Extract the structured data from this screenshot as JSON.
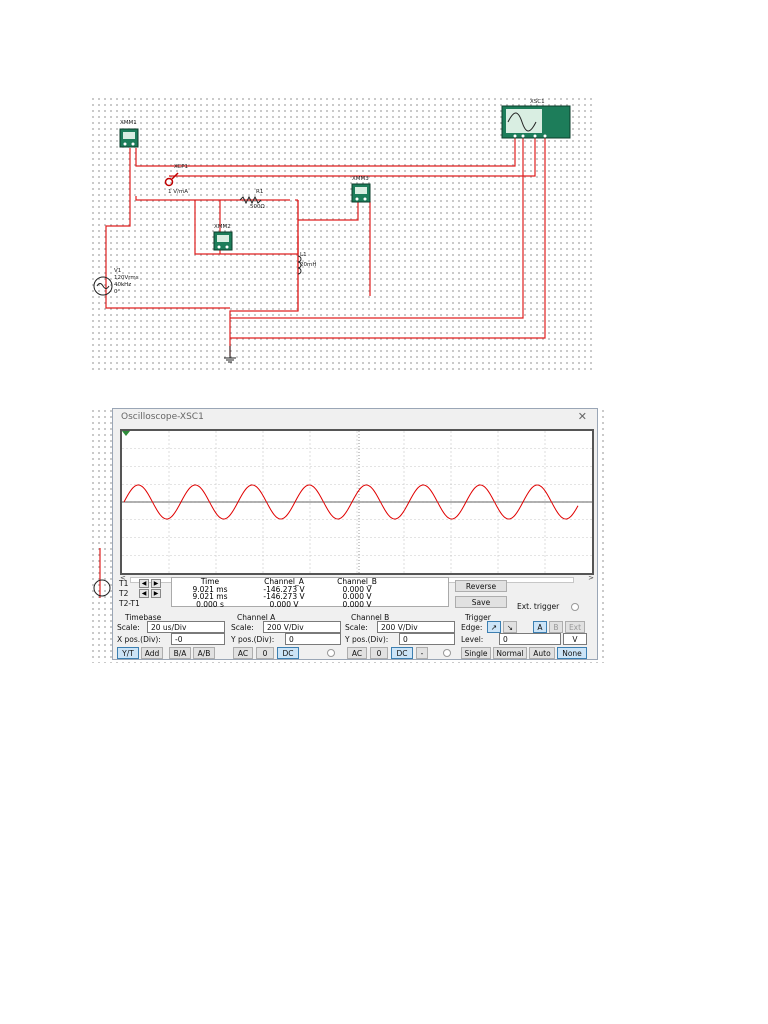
{
  "schematic": {
    "xsc1": {
      "label": "XSC1"
    },
    "xmm1": {
      "label": "XMM1"
    },
    "xmm2": {
      "label": "XMM2"
    },
    "xmm3": {
      "label": "XMM3"
    },
    "xcp1": {
      "label": "XCP1",
      "sub": "1 V/mA"
    },
    "r1": {
      "name": "R1",
      "value": "500Ω"
    },
    "l1": {
      "name": "L1",
      "value": "20mH"
    },
    "v1": {
      "name": "V1",
      "line1": "120Vrms",
      "line2": "40kHz",
      "line3": "0°"
    },
    "colors": {
      "wire": "#e02020",
      "instrument": "#1d7d5a",
      "display": "#d9eee2"
    }
  },
  "scope": {
    "title": "Oscilloscope-XSC1",
    "close": "✕",
    "trace_color": "#e00000",
    "scroll_left": "<",
    "scroll_right": ">",
    "cursors": {
      "t1": "T1",
      "t2": "T2",
      "t2t1": "T2-T1"
    },
    "readout": {
      "headers": [
        "Time",
        "Channel_A",
        "Channel_B"
      ],
      "rows": [
        [
          "9.021 ms",
          "-146.273 V",
          "0.000 V"
        ],
        [
          "9.021 ms",
          "-146.273 V",
          "0.000 V"
        ],
        [
          "0.000 s",
          "0.000 V",
          "0.000 V"
        ]
      ]
    },
    "reverse_label": "Reverse",
    "save_label": "Save",
    "ext_trigger_label": "Ext. trigger",
    "timebase": {
      "header": "Timebase",
      "scale_label": "Scale:",
      "scale_value": "20 us/Div",
      "pos_label": "X pos.(Div):",
      "pos_value": "-0",
      "modes": [
        "Y/T",
        "Add",
        "B/A",
        "A/B"
      ]
    },
    "channel_a": {
      "header": "Channel A",
      "scale_label": "Scale:",
      "scale_value": "200  V/Div",
      "pos_label": "Y pos.(Div):",
      "pos_value": "0",
      "coupling": [
        "AC",
        "0",
        "DC"
      ]
    },
    "channel_b": {
      "header": "Channel B",
      "scale_label": "Scale:",
      "scale_value": "200  V/Div",
      "pos_label": "Y pos.(Div):",
      "pos_value": "0",
      "coupling": [
        "AC",
        "0",
        "DC",
        "-"
      ]
    },
    "trigger": {
      "header": "Trigger",
      "edge_label": "Edge:",
      "edge_buttons": [
        "↗",
        "↘",
        "A",
        "B",
        "Ext"
      ],
      "level_label": "Level:",
      "level_value": "0",
      "level_unit": "V",
      "modes": [
        "Single",
        "Normal",
        "Auto",
        "None"
      ]
    }
  }
}
